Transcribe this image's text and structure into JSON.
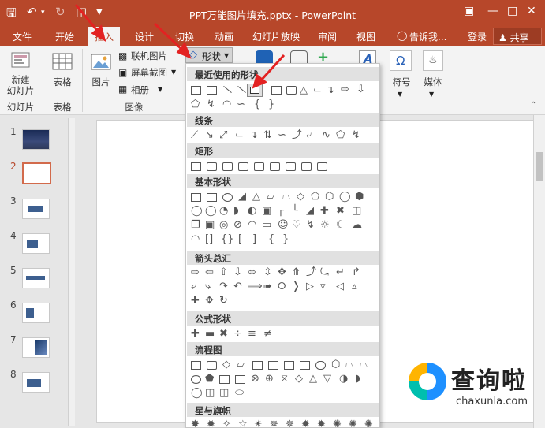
{
  "window": {
    "title": "PPT万能图片填充.pptx - PowerPoint"
  },
  "tabs": [
    {
      "label": "文件"
    },
    {
      "label": "开始"
    },
    {
      "label": "插入"
    },
    {
      "label": "设计"
    },
    {
      "label": "切换"
    },
    {
      "label": "动画"
    },
    {
      "label": "幻灯片放映"
    },
    {
      "label": "审阅"
    },
    {
      "label": "视图"
    },
    {
      "label": "告诉我..."
    },
    {
      "label": "登录"
    },
    {
      "label": "共享"
    }
  ],
  "ribbon": {
    "new_slide": "新建\n幻灯片",
    "new_slide_line1": "新建",
    "new_slide_line2": "幻灯片",
    "table": "表格",
    "picture": "图片",
    "online_pictures": "联机图片",
    "screenshot": "屏幕截图",
    "album": "相册",
    "shapes": "形状",
    "symbol": "符号",
    "media": "媒体",
    "groups": {
      "slides": "幻灯片",
      "tables": "表格",
      "images": "图像"
    }
  },
  "slides": [
    {
      "num": "1"
    },
    {
      "num": "2"
    },
    {
      "num": "3"
    },
    {
      "num": "4"
    },
    {
      "num": "5"
    },
    {
      "num": "6"
    },
    {
      "num": "7"
    },
    {
      "num": "8"
    }
  ],
  "dropdown": {
    "sections": [
      {
        "title": "最近使用的形状"
      },
      {
        "title": "线条"
      },
      {
        "title": "矩形"
      },
      {
        "title": "基本形状"
      },
      {
        "title": "箭头总汇"
      },
      {
        "title": "公式形状"
      },
      {
        "title": "流程图"
      },
      {
        "title": "星与旗帜"
      }
    ]
  },
  "watermark": {
    "title": "查询啦",
    "url": "chaxunla.com"
  },
  "colors": {
    "accent": "#b7472a",
    "arrow": "#e32222"
  }
}
